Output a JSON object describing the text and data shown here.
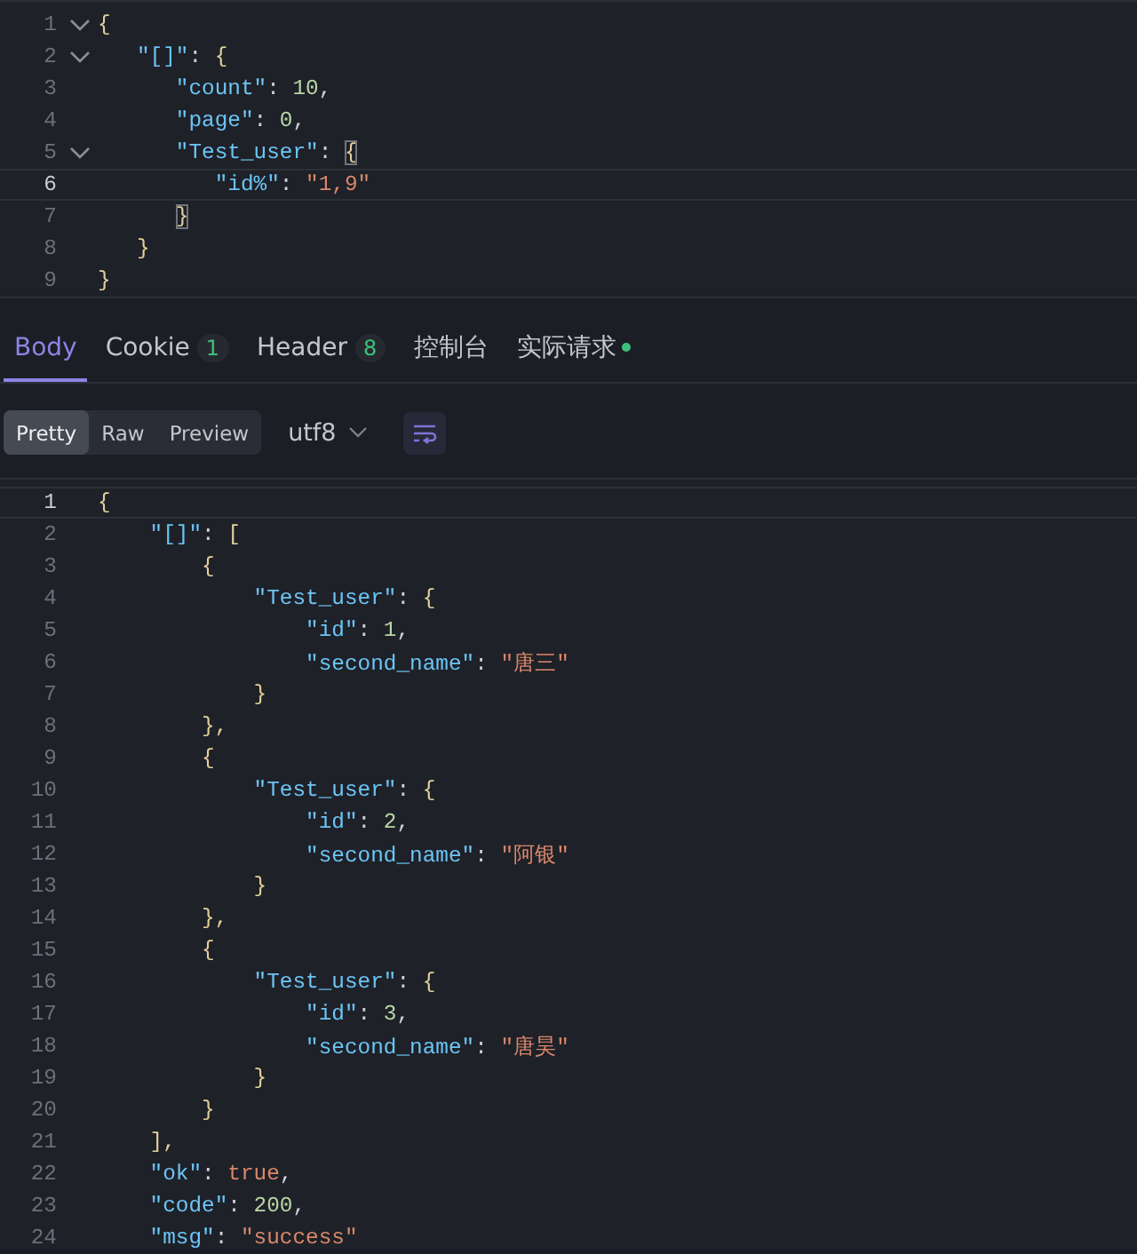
{
  "request_editor": {
    "lines": [
      {
        "number": "1",
        "fold": true,
        "active": false,
        "tokens": [
          {
            "kind": "brace",
            "text": "{"
          }
        ]
      },
      {
        "number": "2",
        "fold": true,
        "active": false,
        "tokens": [
          {
            "kind": "key",
            "text": "   \"[]\""
          },
          {
            "kind": "punct",
            "text": ": "
          },
          {
            "kind": "brace",
            "text": "{"
          }
        ]
      },
      {
        "number": "3",
        "fold": false,
        "active": false,
        "tokens": [
          {
            "kind": "key",
            "text": "      \"count\""
          },
          {
            "kind": "punct",
            "text": ": "
          },
          {
            "kind": "number",
            "text": "10"
          },
          {
            "kind": "punct",
            "text": ","
          }
        ]
      },
      {
        "number": "4",
        "fold": false,
        "active": false,
        "tokens": [
          {
            "kind": "key",
            "text": "      \"page\""
          },
          {
            "kind": "punct",
            "text": ": "
          },
          {
            "kind": "number",
            "text": "0"
          },
          {
            "kind": "punct",
            "text": ","
          }
        ]
      },
      {
        "number": "5",
        "fold": true,
        "active": false,
        "tokens": [
          {
            "kind": "key",
            "text": "      \"Test_user\""
          },
          {
            "kind": "punct",
            "text": ": "
          },
          {
            "kind": "brace",
            "text": "{",
            "matched": true
          }
        ]
      },
      {
        "number": "6",
        "fold": false,
        "active": true,
        "tokens": [
          {
            "kind": "key",
            "text": "         \"id%\""
          },
          {
            "kind": "punct",
            "text": ": "
          },
          {
            "kind": "string",
            "text": "\"1,9\""
          }
        ]
      },
      {
        "number": "7",
        "fold": false,
        "active": false,
        "tokens": [
          {
            "kind": "brace",
            "text": "      }",
            "matched": true
          }
        ]
      },
      {
        "number": "8",
        "fold": false,
        "active": false,
        "tokens": [
          {
            "kind": "brace",
            "text": "   }"
          }
        ]
      },
      {
        "number": "9",
        "fold": false,
        "active": false,
        "tokens": [
          {
            "kind": "brace",
            "text": "}"
          }
        ]
      }
    ]
  },
  "tabs": [
    {
      "label": "Body",
      "selected": true,
      "dot": false
    },
    {
      "label": "Cookie",
      "badge": "1",
      "selected": false,
      "dot": false
    },
    {
      "label": "Header",
      "badge": "8",
      "selected": false,
      "dot": false
    },
    {
      "label": "控制台",
      "selected": false,
      "dot": false
    },
    {
      "label": "实际请求",
      "selected": false,
      "dot": true
    }
  ],
  "formats": [
    {
      "label": "Pretty",
      "selected": true
    },
    {
      "label": "Raw",
      "selected": false
    },
    {
      "label": "Preview",
      "selected": false
    }
  ],
  "encoding": {
    "value": "utf8"
  },
  "response_editor": {
    "lines": [
      {
        "number": "1",
        "active": true,
        "tokens": [
          {
            "kind": "brace",
            "text": "{"
          }
        ]
      },
      {
        "number": "2",
        "active": false,
        "tokens": [
          {
            "kind": "key",
            "text": "    \"[]\""
          },
          {
            "kind": "punct",
            "text": ": "
          },
          {
            "kind": "brace",
            "text": "["
          }
        ]
      },
      {
        "number": "3",
        "active": false,
        "tokens": [
          {
            "kind": "brace",
            "text": "        {"
          }
        ]
      },
      {
        "number": "4",
        "active": false,
        "tokens": [
          {
            "kind": "key",
            "text": "            \"Test_user\""
          },
          {
            "kind": "punct",
            "text": ": "
          },
          {
            "kind": "brace",
            "text": "{"
          }
        ]
      },
      {
        "number": "5",
        "active": false,
        "tokens": [
          {
            "kind": "key",
            "text": "                \"id\""
          },
          {
            "kind": "punct",
            "text": ": "
          },
          {
            "kind": "number",
            "text": "1"
          },
          {
            "kind": "punct",
            "text": ","
          }
        ]
      },
      {
        "number": "6",
        "active": false,
        "tokens": [
          {
            "kind": "key",
            "text": "                \"second_name\""
          },
          {
            "kind": "punct",
            "text": ": "
          },
          {
            "kind": "string",
            "text": "\"唐三\""
          }
        ]
      },
      {
        "number": "7",
        "active": false,
        "tokens": [
          {
            "kind": "brace",
            "text": "            }"
          }
        ]
      },
      {
        "number": "8",
        "active": false,
        "tokens": [
          {
            "kind": "brace",
            "text": "        },"
          }
        ]
      },
      {
        "number": "9",
        "active": false,
        "tokens": [
          {
            "kind": "brace",
            "text": "        {"
          }
        ]
      },
      {
        "number": "10",
        "active": false,
        "tokens": [
          {
            "kind": "key",
            "text": "            \"Test_user\""
          },
          {
            "kind": "punct",
            "text": ": "
          },
          {
            "kind": "brace",
            "text": "{"
          }
        ]
      },
      {
        "number": "11",
        "active": false,
        "tokens": [
          {
            "kind": "key",
            "text": "                \"id\""
          },
          {
            "kind": "punct",
            "text": ": "
          },
          {
            "kind": "number",
            "text": "2"
          },
          {
            "kind": "punct",
            "text": ","
          }
        ]
      },
      {
        "number": "12",
        "active": false,
        "tokens": [
          {
            "kind": "key",
            "text": "                \"second_name\""
          },
          {
            "kind": "punct",
            "text": ": "
          },
          {
            "kind": "string",
            "text": "\"阿银\""
          }
        ]
      },
      {
        "number": "13",
        "active": false,
        "tokens": [
          {
            "kind": "brace",
            "text": "            }"
          }
        ]
      },
      {
        "number": "14",
        "active": false,
        "tokens": [
          {
            "kind": "brace",
            "text": "        },"
          }
        ]
      },
      {
        "number": "15",
        "active": false,
        "tokens": [
          {
            "kind": "brace",
            "text": "        {"
          }
        ]
      },
      {
        "number": "16",
        "active": false,
        "tokens": [
          {
            "kind": "key",
            "text": "            \"Test_user\""
          },
          {
            "kind": "punct",
            "text": ": "
          },
          {
            "kind": "brace",
            "text": "{"
          }
        ]
      },
      {
        "number": "17",
        "active": false,
        "tokens": [
          {
            "kind": "key",
            "text": "                \"id\""
          },
          {
            "kind": "punct",
            "text": ": "
          },
          {
            "kind": "number",
            "text": "3"
          },
          {
            "kind": "punct",
            "text": ","
          }
        ]
      },
      {
        "number": "18",
        "active": false,
        "tokens": [
          {
            "kind": "key",
            "text": "                \"second_name\""
          },
          {
            "kind": "punct",
            "text": ": "
          },
          {
            "kind": "string",
            "text": "\"唐昊\""
          }
        ]
      },
      {
        "number": "19",
        "active": false,
        "tokens": [
          {
            "kind": "brace",
            "text": "            }"
          }
        ]
      },
      {
        "number": "20",
        "active": false,
        "tokens": [
          {
            "kind": "brace",
            "text": "        }"
          }
        ]
      },
      {
        "number": "21",
        "active": false,
        "tokens": [
          {
            "kind": "brace",
            "text": "    ],"
          }
        ]
      },
      {
        "number": "22",
        "active": false,
        "tokens": [
          {
            "kind": "key",
            "text": "    \"ok\""
          },
          {
            "kind": "punct",
            "text": ": "
          },
          {
            "kind": "bool",
            "text": "true"
          },
          {
            "kind": "punct",
            "text": ","
          }
        ]
      },
      {
        "number": "23",
        "active": false,
        "tokens": [
          {
            "kind": "key",
            "text": "    \"code\""
          },
          {
            "kind": "punct",
            "text": ": "
          },
          {
            "kind": "number",
            "text": "200"
          },
          {
            "kind": "punct",
            "text": ","
          }
        ]
      },
      {
        "number": "24",
        "active": false,
        "tokens": [
          {
            "kind": "key",
            "text": "    \"msg\""
          },
          {
            "kind": "punct",
            "text": ": "
          },
          {
            "kind": "string",
            "text": "\"success\""
          }
        ]
      }
    ]
  }
}
